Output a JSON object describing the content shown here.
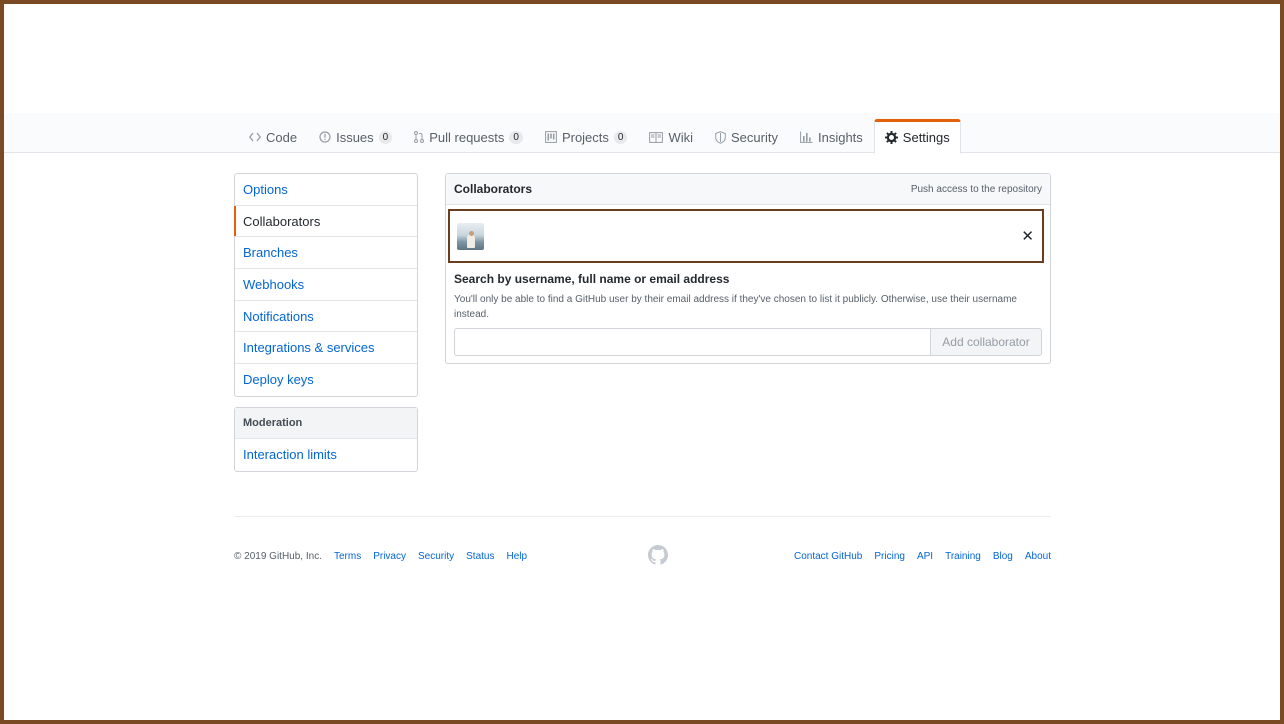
{
  "repo_nav": {
    "tabs": [
      {
        "label": "Code",
        "icon": "code-icon"
      },
      {
        "label": "Issues",
        "icon": "issue-icon",
        "count": "0"
      },
      {
        "label": "Pull requests",
        "icon": "pull-request-icon",
        "count": "0"
      },
      {
        "label": "Projects",
        "icon": "project-icon",
        "count": "0"
      },
      {
        "label": "Wiki",
        "icon": "book-icon"
      },
      {
        "label": "Security",
        "icon": "shield-icon"
      },
      {
        "label": "Insights",
        "icon": "graph-icon"
      },
      {
        "label": "Settings",
        "icon": "gear-icon",
        "selected": true
      }
    ]
  },
  "sidebar": {
    "items": [
      {
        "label": "Options"
      },
      {
        "label": "Collaborators",
        "selected": true
      },
      {
        "label": "Branches"
      },
      {
        "label": "Webhooks"
      },
      {
        "label": "Notifications"
      },
      {
        "label": "Integrations & services"
      },
      {
        "label": "Deploy keys"
      }
    ],
    "moderation": {
      "heading": "Moderation",
      "items": [
        {
          "label": "Interaction limits"
        }
      ]
    }
  },
  "collaborators": {
    "title": "Collaborators",
    "note": "Push access to the repository",
    "remove_symbol": "✕",
    "search": {
      "label": "Search by username, full name or email address",
      "help": "You'll only be able to find a GitHub user by their email address if they've chosen to list it publicly. Otherwise, use their username instead.",
      "input_value": "",
      "button_label": "Add collaborator"
    }
  },
  "footer": {
    "copyright": "© 2019 GitHub, Inc.",
    "left_links": [
      "Terms",
      "Privacy",
      "Security",
      "Status",
      "Help"
    ],
    "right_links": [
      "Contact GitHub",
      "Pricing",
      "API",
      "Training",
      "Blog",
      "About"
    ]
  },
  "colors": {
    "accent_tab": "#e36209",
    "link": "#0366d6",
    "highlight_border": "#6b3d1c",
    "frame": "#7a4a24"
  }
}
